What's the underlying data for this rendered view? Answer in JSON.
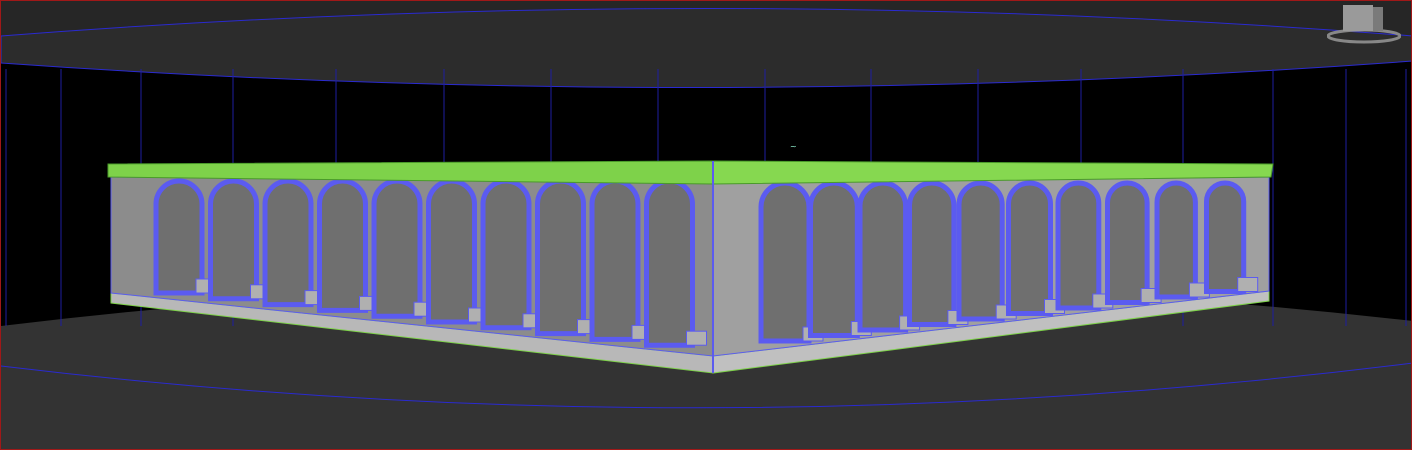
{
  "viewport": {
    "name": "perspective-viewport",
    "colors": {
      "border": "#a01818",
      "background": "#000000",
      "ground": "#333333",
      "sky_dome": "#262626",
      "wire": "#2a2ad0",
      "selection_blue": "#5b5bf0",
      "trim_green": "#7ed24a",
      "wall": "#a8a8a8"
    },
    "arch_counts": {
      "left_facade": 10,
      "right_facade": 10
    }
  },
  "viewcube": {
    "icon": "viewcube-icon"
  }
}
